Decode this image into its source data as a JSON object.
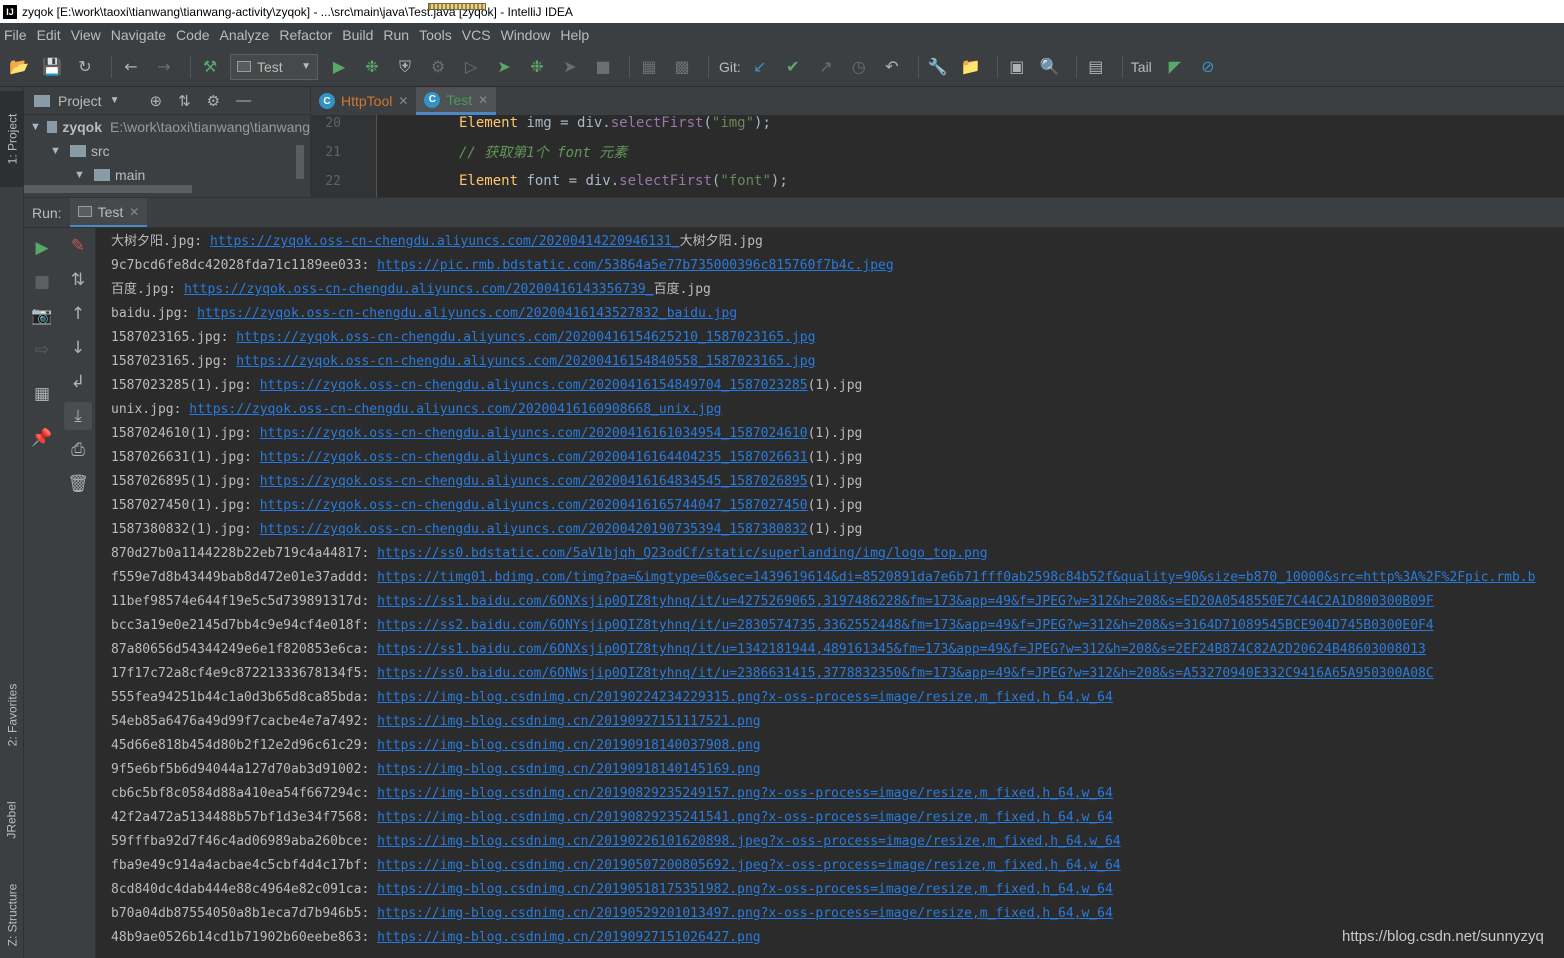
{
  "window": {
    "title": "zyqok [E:\\work\\taoxi\\tianwang\\tianwang-activity\\zyqok] - ...\\src\\main\\java\\Test.java [zyqok] - IntelliJ IDEA",
    "app_icon_text": "IJ"
  },
  "menu": [
    "File",
    "Edit",
    "View",
    "Navigate",
    "Code",
    "Analyze",
    "Refactor",
    "Build",
    "Run",
    "Tools",
    "VCS",
    "Window",
    "Help"
  ],
  "toolbar": {
    "run_config": "Test",
    "git_label": "Git:",
    "tail_label": "Tail"
  },
  "left_strip": {
    "project_tab": "1: Project",
    "favorites_tab": "2: Favorites",
    "jrebel_tab": "JRebel",
    "structure_tab": "Z: Structure"
  },
  "project_panel": {
    "title": "Project",
    "root_name": "zyqok",
    "root_path": "E:\\work\\taoxi\\tianwang\\tianwang",
    "src": "src",
    "main": "main"
  },
  "editor": {
    "tabs": [
      {
        "label": "HttpTool",
        "active": false
      },
      {
        "label": "Test",
        "active": true
      }
    ],
    "lines": [
      {
        "num": "20",
        "type": "Element",
        "var": " img = div.",
        "method": "selectFirst",
        "arg": "\"img\"",
        "end": ");"
      },
      {
        "num": "21",
        "comment": "// 获取第1个 font 元素"
      },
      {
        "num": "22",
        "type": "Element",
        "var": " font = div.",
        "method": "selectFirst",
        "arg": "\"font\"",
        "end": ");"
      }
    ]
  },
  "run_panel": {
    "label": "Run:",
    "tab": "Test"
  },
  "console": [
    {
      "prefix": "大树夕阳.jpg: ",
      "link": "https://zyqok.oss-cn-chengdu.aliyuncs.com/20200414220946131_",
      "suffix": "大树夕阳.jpg"
    },
    {
      "prefix": "9c7bcd6fe8dc42028fda71c1189ee033: ",
      "link": "https://pic.rmb.bdstatic.com/53864a5e77b735000396c815760f7b4c.jpeg",
      "suffix": ""
    },
    {
      "prefix": "百度.jpg: ",
      "link": "https://zyqok.oss-cn-chengdu.aliyuncs.com/20200416143356739_",
      "suffix": "百度.jpg"
    },
    {
      "prefix": "baidu.jpg: ",
      "link": "https://zyqok.oss-cn-chengdu.aliyuncs.com/20200416143527832_baidu.jpg",
      "suffix": ""
    },
    {
      "prefix": "1587023165.jpg: ",
      "link": "https://zyqok.oss-cn-chengdu.aliyuncs.com/20200416154625210_1587023165.jpg",
      "suffix": ""
    },
    {
      "prefix": "1587023165.jpg: ",
      "link": "https://zyqok.oss-cn-chengdu.aliyuncs.com/20200416154840558_1587023165.jpg",
      "suffix": ""
    },
    {
      "prefix": "1587023285(1).jpg: ",
      "link": "https://zyqok.oss-cn-chengdu.aliyuncs.com/20200416154849704_1587023285",
      "suffix": "(1).jpg"
    },
    {
      "prefix": "unix.jpg: ",
      "link": "https://zyqok.oss-cn-chengdu.aliyuncs.com/20200416160908668_unix.jpg",
      "suffix": ""
    },
    {
      "prefix": "1587024610(1).jpg: ",
      "link": "https://zyqok.oss-cn-chengdu.aliyuncs.com/20200416161034954_1587024610",
      "suffix": "(1).jpg"
    },
    {
      "prefix": "1587026631(1).jpg: ",
      "link": "https://zyqok.oss-cn-chengdu.aliyuncs.com/20200416164404235_1587026631",
      "suffix": "(1).jpg"
    },
    {
      "prefix": "1587026895(1).jpg: ",
      "link": "https://zyqok.oss-cn-chengdu.aliyuncs.com/20200416164834545_1587026895",
      "suffix": "(1).jpg"
    },
    {
      "prefix": "1587027450(1).jpg: ",
      "link": "https://zyqok.oss-cn-chengdu.aliyuncs.com/20200416165744047_1587027450",
      "suffix": "(1).jpg"
    },
    {
      "prefix": "1587380832(1).jpg: ",
      "link": "https://zyqok.oss-cn-chengdu.aliyuncs.com/20200420190735394_1587380832",
      "suffix": "(1).jpg"
    },
    {
      "prefix": "870d27b0a1144228b22eb719c4a44817: ",
      "link": "https://ss0.bdstatic.com/5aV1bjqh_Q23odCf/static/superlanding/img/logo_top.png",
      "suffix": ""
    },
    {
      "prefix": "f559e7d8b43449bab8d472e01e37addd: ",
      "link": "https://timg01.bdimg.com/timg?pa=&imgtype=0&sec=1439619614&di=8520891da7e6b71fff0ab2598c84b52f&quality=90&size=b870_10000&src=http%3A%2F%2Fpic.rmb.b",
      "suffix": ""
    },
    {
      "prefix": "11bef98574e644f19e5c5d739891317d: ",
      "link": "https://ss1.baidu.com/6ONXsjip0QIZ8tyhnq/it/u=4275269065,3197486228&fm=173&app=49&f=JPEG?w=312&h=208&s=ED20A0548550E7C44C2A1D800300B09F",
      "suffix": ""
    },
    {
      "prefix": "bcc3a19e0e2145d7bb4c9e94cf4e018f: ",
      "link": "https://ss2.baidu.com/6ONYsjip0QIZ8tyhnq/it/u=2830574735,3362552448&fm=173&app=49&f=JPEG?w=312&h=208&s=3164D71089545BCE904D745B0300E0F4",
      "suffix": ""
    },
    {
      "prefix": "87a80656d54344249e6e1f820853e6ca: ",
      "link": "https://ss1.baidu.com/6ONXsjip0QIZ8tyhnq/it/u=1342181944,489161345&fm=173&app=49&f=JPEG?w=312&h=208&s=2EF24B874C82A2D20624B48603008013",
      "suffix": ""
    },
    {
      "prefix": "17f17c72a8cf4e9c87221333678134f5: ",
      "link": "https://ss0.baidu.com/6ONWsjip0QIZ8tyhnq/it/u=2386631415,3778832350&fm=173&app=49&f=JPEG?w=312&h=208&s=A53270940E332C9416A65A950300A08C",
      "suffix": ""
    },
    {
      "prefix": "555fea94251b44c1a0d3b65d8ca85bda: ",
      "link": "https://img-blog.csdnimg.cn/20190224234229315.png?x-oss-process=image/resize,m_fixed,h_64,w_64",
      "suffix": ""
    },
    {
      "prefix": "54eb85a6476a49d99f7cacbe4e7a7492: ",
      "link": "https://img-blog.csdnimg.cn/20190927151117521.png",
      "suffix": ""
    },
    {
      "prefix": "45d66e818b454d80b2f12e2d96c61c29: ",
      "link": "https://img-blog.csdnimg.cn/20190918140037908.png",
      "suffix": ""
    },
    {
      "prefix": "9f5e6bf5b6d94044a127d70ab3d91002: ",
      "link": "https://img-blog.csdnimg.cn/20190918140145169.png",
      "suffix": ""
    },
    {
      "prefix": "cb6c5bf8c0584d88a410ea54f667294c: ",
      "link": "https://img-blog.csdnimg.cn/20190829235249157.png?x-oss-process=image/resize,m_fixed,h_64,w_64",
      "suffix": ""
    },
    {
      "prefix": "42f2a472a5134488b57bf1d3e34f7568: ",
      "link": "https://img-blog.csdnimg.cn/20190829235241541.png?x-oss-process=image/resize,m_fixed,h_64,w_64",
      "suffix": ""
    },
    {
      "prefix": "59fffba92d7f46c4ad06989aba260bce: ",
      "link": "https://img-blog.csdnimg.cn/20190226101620898.jpeg?x-oss-process=image/resize,m_fixed,h_64,w_64",
      "suffix": ""
    },
    {
      "prefix": "fba9e49c914a4acbae4c5cbf4d4c17bf: ",
      "link": "https://img-blog.csdnimg.cn/20190507200805692.jpeg?x-oss-process=image/resize,m_fixed,h_64,w_64",
      "suffix": ""
    },
    {
      "prefix": "8cd840dc4dab444e88c4964e82c091ca: ",
      "link": "https://img-blog.csdnimg.cn/20190518175351982.png?x-oss-process=image/resize,m_fixed,h_64,w_64",
      "suffix": ""
    },
    {
      "prefix": "b70a04db87554050a8b1eca7d7b946b5: ",
      "link": "https://img-blog.csdnimg.cn/20190529201013497.png?x-oss-process=image/resize,m_fixed,h_64,w_64",
      "suffix": ""
    },
    {
      "prefix": "48b9ae0526b14cd1b71902b60eebe863: ",
      "link": "https://img-blog.csdnimg.cn/20190927151026427.png",
      "suffix": ""
    }
  ],
  "watermark": "https://blog.csdn.net/sunnyzyq",
  "colors": {
    "background": "#2b2b2b",
    "panel": "#3c3f41",
    "link": "#287bde",
    "text": "#bbbbbb",
    "run_green": "#59a869"
  }
}
